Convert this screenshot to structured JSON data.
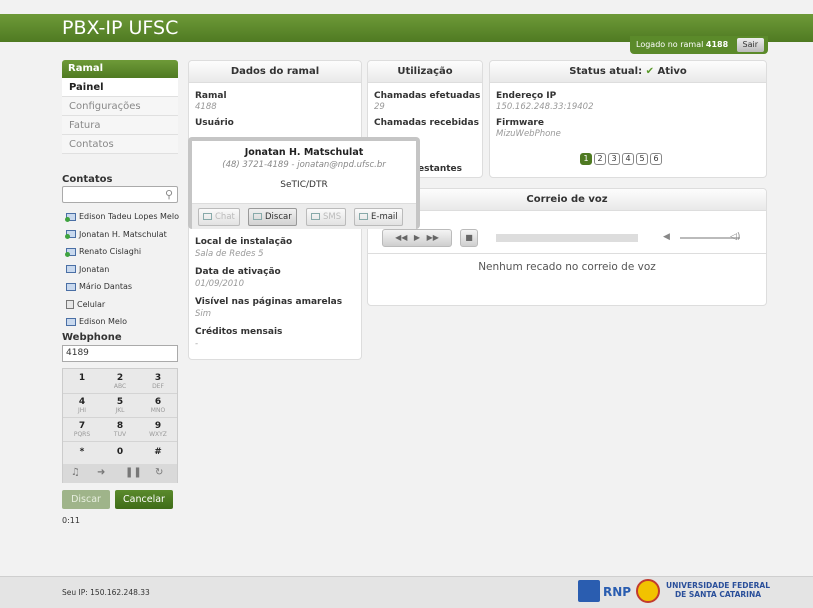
{
  "header": {
    "title": "PBX-IP UFSC",
    "login_text": "Logado no ramal",
    "login_ramal": "4188",
    "logout_label": "Sair"
  },
  "sidebar": {
    "section_title": "Ramal",
    "items": [
      {
        "label": "Painel",
        "active": true
      },
      {
        "label": "Configurações"
      },
      {
        "label": "Fatura"
      },
      {
        "label": "Contatos"
      }
    ],
    "contacts_title": "Contatos",
    "contacts_search_value": "",
    "contacts": [
      {
        "name": "Edison Tadeu Lopes Melo",
        "icon": "contact-online-icon"
      },
      {
        "name": "Jonatan H. Matschulat",
        "icon": "contact-online-icon"
      },
      {
        "name": "Renato Cislaghi",
        "icon": "contact-online-icon"
      },
      {
        "name": "Jonatan",
        "icon": "contact-icon"
      },
      {
        "name": "Mário Dantas",
        "icon": "contact-icon"
      },
      {
        "name": "Celular",
        "icon": "mobile-icon"
      },
      {
        "name": "Edison Melo",
        "icon": "contact-icon"
      }
    ],
    "webphone_title": "Webphone",
    "webphone_value": "4189",
    "keypad": [
      {
        "digit": "1",
        "letters": ""
      },
      {
        "digit": "2",
        "letters": "ABC"
      },
      {
        "digit": "3",
        "letters": "DEF"
      },
      {
        "digit": "4",
        "letters": "JHI"
      },
      {
        "digit": "5",
        "letters": "JKL"
      },
      {
        "digit": "6",
        "letters": "MNO"
      },
      {
        "digit": "7",
        "letters": "PQRS"
      },
      {
        "digit": "8",
        "letters": "TUV"
      },
      {
        "digit": "9",
        "letters": "WXYZ"
      },
      {
        "digit": "*",
        "letters": ""
      },
      {
        "digit": "0",
        "letters": ""
      },
      {
        "digit": "#",
        "letters": ""
      }
    ],
    "dial_label": "Discar",
    "cancel_label": "Cancelar",
    "timer": "0:11"
  },
  "ramal_panel": {
    "title": "Dados do ramal",
    "fields": [
      {
        "label": "Ramal",
        "value": "4188"
      },
      {
        "label": "Usuário",
        "value": ""
      },
      {
        "label": "Local de instalação",
        "value": "Sala de Redes 5"
      },
      {
        "label": "Data de ativação",
        "value": "01/09/2010"
      },
      {
        "label": "Visível nas páginas amarelas",
        "value": "Sim"
      },
      {
        "label": "Créditos mensais",
        "value": "-"
      }
    ]
  },
  "usage_panel": {
    "title": "Utilização",
    "fields": [
      {
        "label": "Chamadas efetuadas",
        "value": "29"
      },
      {
        "label": "Chamadas recebidas",
        "value": ""
      },
      {
        "label": "estantes",
        "value": ""
      }
    ]
  },
  "status_panel": {
    "title_prefix": "Status atual:",
    "status": "Ativo",
    "ip_label": "Endereço IP",
    "ip_value": "150.162.248.33:19402",
    "firmware_label": "Firmware",
    "firmware_value": "MizuWebPhone",
    "pages": [
      "1",
      "2",
      "3",
      "4",
      "5",
      "6"
    ],
    "current_page": "1"
  },
  "voicemail_panel": {
    "title": "Correio de voz",
    "empty_message": "Nenhum recado no correio de voz"
  },
  "popup": {
    "name": "Jonatan H. Matschulat",
    "contact_line": "(48) 3721-4189 - jonatan@npd.ufsc.br",
    "department": "SeTIC/DTR",
    "actions": [
      {
        "label": "Chat",
        "enabled": false
      },
      {
        "label": "Discar",
        "enabled": true
      },
      {
        "label": "SMS",
        "enabled": false
      },
      {
        "label": "E-mail",
        "enabled": true
      }
    ]
  },
  "footer": {
    "ip_text": "Seu IP: 150.162.248.33",
    "rnp_text": "RNP",
    "ufsc_line1": "UNIVERSIDADE FEDERAL",
    "ufsc_line2": "DE SANTA CATARINA"
  },
  "colors": {
    "brand_green": "#4f7a22",
    "accent_blue": "#2a5db0"
  }
}
